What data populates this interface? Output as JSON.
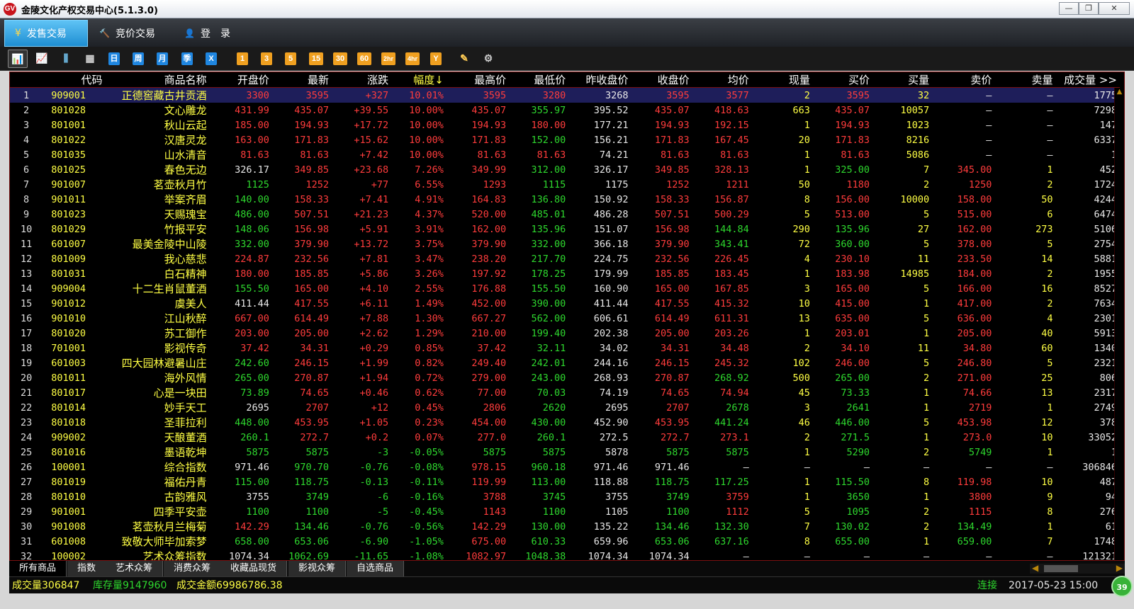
{
  "window": {
    "title": "金陵文化产权交易中心(5.1.3.0)",
    "app_icon": "jl-logo-icon",
    "minimize": "—",
    "restore": "❐",
    "close": "✕"
  },
  "nav": {
    "tabs": [
      {
        "label": "发售交易",
        "icon": "yen-icon",
        "glyph": "¥",
        "active": true
      },
      {
        "label": "竞价交易",
        "icon": "gavel-icon",
        "glyph": "🔨",
        "active": false
      },
      {
        "label": "登　录",
        "icon": "user-icon",
        "glyph": "👤",
        "active": false
      }
    ]
  },
  "toolbar": {
    "chart_buttons": [
      {
        "icon": "bar-chart-icon",
        "glyph": "📊"
      },
      {
        "icon": "line-chart-icon",
        "glyph": "📈"
      },
      {
        "icon": "candlestick-icon",
        "glyph": "⫼"
      },
      {
        "icon": "calendar-icon",
        "glyph": "▦"
      }
    ],
    "period_buttons": [
      "日",
      "周",
      "月",
      "季",
      "X"
    ],
    "minute_buttons": [
      "1",
      "3",
      "5",
      "15",
      "30",
      "60",
      "2hr",
      "4hr",
      "Y"
    ],
    "tool_buttons": [
      {
        "icon": "edit-icon",
        "glyph": "✎"
      },
      {
        "icon": "gear-icon",
        "glyph": "⚙"
      }
    ]
  },
  "columns": [
    "",
    "代码",
    "商品名称",
    "开盘价",
    "最新",
    "涨跌",
    "幅度↓",
    "最高价",
    "最低价",
    "昨收盘价",
    "收盘价",
    "均价",
    "现量",
    "买价",
    "买量",
    "卖价",
    "卖量",
    "成交量 >>"
  ],
  "rows": [
    [
      "1",
      "909001",
      "正德窖藏古井贡酒",
      "3300",
      "3595",
      "+327",
      "10.01%",
      "3595",
      "3280",
      "3268",
      "3595",
      "3577",
      "2",
      "3595",
      "32",
      "—",
      "—",
      "1775"
    ],
    [
      "2",
      "801028",
      "文心雕龙",
      "431.99",
      "435.07",
      "+39.55",
      "10.00%",
      "435.07",
      "355.97",
      "395.52",
      "435.07",
      "418.63",
      "663",
      "435.07",
      "10057",
      "—",
      "—",
      "7298"
    ],
    [
      "3",
      "801001",
      "秋山云起",
      "185.00",
      "194.93",
      "+17.72",
      "10.00%",
      "194.93",
      "180.00",
      "177.21",
      "194.93",
      "192.15",
      "1",
      "194.93",
      "1023",
      "—",
      "—",
      "147"
    ],
    [
      "4",
      "801022",
      "汉唐灵龙",
      "163.00",
      "171.83",
      "+15.62",
      "10.00%",
      "171.83",
      "152.00",
      "156.21",
      "171.83",
      "167.45",
      "20",
      "171.83",
      "8216",
      "—",
      "—",
      "6337"
    ],
    [
      "5",
      "801035",
      "山水清音",
      "81.63",
      "81.63",
      "+7.42",
      "10.00%",
      "81.63",
      "81.63",
      "74.21",
      "81.63",
      "81.63",
      "1",
      "81.63",
      "5086",
      "—",
      "—",
      "1"
    ],
    [
      "6",
      "801025",
      "春色无边",
      "326.17",
      "349.85",
      "+23.68",
      "7.26%",
      "349.99",
      "312.00",
      "326.17",
      "349.85",
      "328.13",
      "1",
      "325.00",
      "7",
      "345.00",
      "1",
      "452"
    ],
    [
      "7",
      "901007",
      "茗壶秋月竹",
      "1125",
      "1252",
      "+77",
      "6.55%",
      "1293",
      "1115",
      "1175",
      "1252",
      "1211",
      "50",
      "1180",
      "2",
      "1250",
      "2",
      "1724"
    ],
    [
      "8",
      "901011",
      "举案齐眉",
      "140.00",
      "158.33",
      "+7.41",
      "4.91%",
      "164.83",
      "136.80",
      "150.92",
      "158.33",
      "156.87",
      "8",
      "156.00",
      "10000",
      "158.00",
      "50",
      "4244"
    ],
    [
      "9",
      "801023",
      "天赐瑰宝",
      "486.00",
      "507.51",
      "+21.23",
      "4.37%",
      "520.00",
      "485.01",
      "486.28",
      "507.51",
      "500.29",
      "5",
      "513.00",
      "5",
      "515.00",
      "6",
      "6474"
    ],
    [
      "10",
      "801029",
      "竹报平安",
      "148.06",
      "156.98",
      "+5.91",
      "3.91%",
      "162.00",
      "135.96",
      "151.07",
      "156.98",
      "144.84",
      "290",
      "135.96",
      "27",
      "162.00",
      "273",
      "5106"
    ],
    [
      "11",
      "601007",
      "最美金陵中山陵",
      "332.00",
      "379.90",
      "+13.72",
      "3.75%",
      "379.90",
      "332.00",
      "366.18",
      "379.90",
      "343.41",
      "72",
      "360.00",
      "5",
      "378.00",
      "5",
      "2754"
    ],
    [
      "12",
      "801009",
      "我心慈悲",
      "224.87",
      "232.56",
      "+7.81",
      "3.47%",
      "238.20",
      "217.70",
      "224.75",
      "232.56",
      "226.45",
      "4",
      "230.10",
      "11",
      "233.50",
      "14",
      "5881"
    ],
    [
      "13",
      "801031",
      "白石精神",
      "180.00",
      "185.85",
      "+5.86",
      "3.26%",
      "197.92",
      "178.25",
      "179.99",
      "185.85",
      "183.45",
      "1",
      "183.98",
      "14985",
      "184.00",
      "2",
      "1955"
    ],
    [
      "14",
      "909004",
      "十二生肖鼠董酒",
      "155.50",
      "165.00",
      "+4.10",
      "2.55%",
      "176.88",
      "155.50",
      "160.90",
      "165.00",
      "167.85",
      "3",
      "165.00",
      "5",
      "166.00",
      "16",
      "8527"
    ],
    [
      "15",
      "901012",
      "虞美人",
      "411.44",
      "417.55",
      "+6.11",
      "1.49%",
      "452.00",
      "390.00",
      "411.44",
      "417.55",
      "415.32",
      "10",
      "415.00",
      "1",
      "417.00",
      "2",
      "7634"
    ],
    [
      "16",
      "901010",
      "江山秋醉",
      "667.00",
      "614.49",
      "+7.88",
      "1.30%",
      "667.27",
      "562.00",
      "606.61",
      "614.49",
      "611.31",
      "13",
      "635.00",
      "5",
      "636.00",
      "4",
      "2301"
    ],
    [
      "17",
      "801020",
      "苏工御作",
      "203.00",
      "205.00",
      "+2.62",
      "1.29%",
      "210.00",
      "199.40",
      "202.38",
      "205.00",
      "203.26",
      "1",
      "203.01",
      "1",
      "205.00",
      "40",
      "5913"
    ],
    [
      "18",
      "701001",
      "影视传奇",
      "37.42",
      "34.31",
      "+0.29",
      "0.85%",
      "37.42",
      "32.11",
      "34.02",
      "34.31",
      "34.48",
      "2",
      "34.10",
      "11",
      "34.80",
      "60",
      "1340"
    ],
    [
      "19",
      "601003",
      "四大园林避暑山庄",
      "242.60",
      "246.15",
      "+1.99",
      "0.82%",
      "249.40",
      "242.01",
      "244.16",
      "246.15",
      "245.32",
      "102",
      "246.00",
      "5",
      "246.80",
      "5",
      "2321"
    ],
    [
      "20",
      "801011",
      "海外风情",
      "265.00",
      "270.87",
      "+1.94",
      "0.72%",
      "279.00",
      "243.00",
      "268.93",
      "270.87",
      "268.92",
      "500",
      "265.00",
      "2",
      "271.00",
      "25",
      "806"
    ],
    [
      "21",
      "801017",
      "心是一块田",
      "73.89",
      "74.65",
      "+0.46",
      "0.62%",
      "77.00",
      "70.03",
      "74.19",
      "74.65",
      "74.94",
      "45",
      "73.33",
      "1",
      "74.66",
      "13",
      "2317"
    ],
    [
      "22",
      "801014",
      "妙手天工",
      "2695",
      "2707",
      "+12",
      "0.45%",
      "2806",
      "2620",
      "2695",
      "2707",
      "2678",
      "3",
      "2641",
      "1",
      "2719",
      "1",
      "2749"
    ],
    [
      "23",
      "801018",
      "圣菲拉利",
      "448.00",
      "453.95",
      "+1.05",
      "0.23%",
      "454.00",
      "430.00",
      "452.90",
      "453.95",
      "441.24",
      "46",
      "446.00",
      "5",
      "453.98",
      "12",
      "378"
    ],
    [
      "24",
      "909002",
      "天酿董酒",
      "260.1",
      "272.7",
      "+0.2",
      "0.07%",
      "277.0",
      "260.1",
      "272.5",
      "272.7",
      "273.1",
      "2",
      "271.5",
      "1",
      "273.0",
      "10",
      "33052"
    ],
    [
      "25",
      "801016",
      "墨语乾坤",
      "5875",
      "5875",
      "-3",
      "-0.05%",
      "5875",
      "5875",
      "5878",
      "5875",
      "5875",
      "1",
      "5290",
      "2",
      "5749",
      "1",
      "1"
    ],
    [
      "26",
      "100001",
      "综合指数",
      "971.46",
      "970.70",
      "-0.76",
      "-0.08%",
      "978.15",
      "960.18",
      "971.46",
      "971.46",
      "—",
      "—",
      "—",
      "—",
      "—",
      "—",
      "306846"
    ],
    [
      "27",
      "801019",
      "福佑丹青",
      "115.00",
      "118.75",
      "-0.13",
      "-0.11%",
      "119.99",
      "113.00",
      "118.88",
      "118.75",
      "117.25",
      "1",
      "115.50",
      "8",
      "119.98",
      "10",
      "487"
    ],
    [
      "28",
      "801010",
      "古韵雅风",
      "3755",
      "3749",
      "-6",
      "-0.16%",
      "3788",
      "3745",
      "3755",
      "3749",
      "3759",
      "1",
      "3650",
      "1",
      "3800",
      "9",
      "94"
    ],
    [
      "29",
      "901001",
      "四季平安壶",
      "1100",
      "1100",
      "-5",
      "-0.45%",
      "1143",
      "1100",
      "1105",
      "1100",
      "1112",
      "5",
      "1095",
      "2",
      "1115",
      "8",
      "276"
    ],
    [
      "30",
      "901008",
      "茗壶秋月兰梅菊",
      "142.29",
      "134.46",
      "-0.76",
      "-0.56%",
      "142.29",
      "130.00",
      "135.22",
      "134.46",
      "132.30",
      "7",
      "130.02",
      "2",
      "134.49",
      "1",
      "61"
    ],
    [
      "31",
      "601008",
      "致敬大师毕加索梦",
      "658.00",
      "653.06",
      "-6.90",
      "-1.05%",
      "675.00",
      "610.33",
      "659.96",
      "653.06",
      "637.16",
      "8",
      "655.00",
      "1",
      "659.00",
      "7",
      "1748"
    ],
    [
      "32",
      "100002",
      "艺术众筹指数",
      "1074.34",
      "1062.69",
      "-11.65",
      "-1.08%",
      "1082.97",
      "1048.38",
      "1074.34",
      "1074.34",
      "—",
      "—",
      "—",
      "—",
      "—",
      "—",
      "121321"
    ]
  ],
  "bottom_tabs": [
    "所有商品",
    "指数",
    "艺术众筹",
    "消费众筹",
    "收藏品现货",
    "影视众筹",
    "自选商品"
  ],
  "status": {
    "volume": "成交量306847",
    "inventory": "库存量9147960",
    "amount": "成交金额69986786.38",
    "connection": "连接",
    "datetime": "2017-05-23 15:00"
  },
  "badge": "39",
  "colors": {
    "up": "#ff3c3c",
    "down": "#2ed82e",
    "flat": "#e8e8e8",
    "code": "#ffff44",
    "accent": "#1e8ed2"
  }
}
